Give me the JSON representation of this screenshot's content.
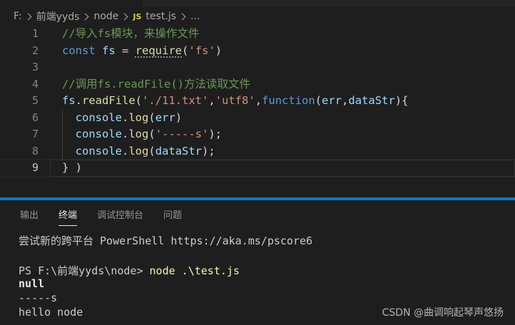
{
  "breadcrumb": {
    "drive": "F:",
    "folder1": "前端yyds",
    "folder2": "node",
    "file_icon": "JS",
    "file": "test.js",
    "more": "..."
  },
  "editor": {
    "lines": [
      {
        "num": "1",
        "tokens": [
          {
            "t": "//导入fs模块，来操作文件",
            "c": "comment"
          }
        ]
      },
      {
        "num": "2",
        "tokens": [
          {
            "t": "const",
            "c": "keyword"
          },
          {
            "t": " ",
            "c": "text"
          },
          {
            "t": "fs",
            "c": "var"
          },
          {
            "t": " = ",
            "c": "text"
          },
          {
            "t": "require",
            "c": "func squiggle"
          },
          {
            "t": "(",
            "c": "text"
          },
          {
            "t": "'fs'",
            "c": "string"
          },
          {
            "t": ")",
            "c": "text"
          }
        ]
      },
      {
        "num": "3",
        "tokens": []
      },
      {
        "num": "4",
        "tokens": [
          {
            "t": "//调用fs.readFile()方法读取文件",
            "c": "comment"
          }
        ]
      },
      {
        "num": "5",
        "tokens": [
          {
            "t": "fs",
            "c": "var"
          },
          {
            "t": ".",
            "c": "text"
          },
          {
            "t": "readFile",
            "c": "func"
          },
          {
            "t": "(",
            "c": "text"
          },
          {
            "t": "'./11.txt'",
            "c": "string"
          },
          {
            "t": ",",
            "c": "text"
          },
          {
            "t": "'utf8'",
            "c": "string"
          },
          {
            "t": ",",
            "c": "text"
          },
          {
            "t": "function",
            "c": "keyword"
          },
          {
            "t": "(",
            "c": "text"
          },
          {
            "t": "err",
            "c": "var"
          },
          {
            "t": ",",
            "c": "text"
          },
          {
            "t": "dataStr",
            "c": "var"
          },
          {
            "t": "){",
            "c": "text"
          }
        ]
      },
      {
        "num": "6",
        "tokens": [
          {
            "t": "  ",
            "c": "text"
          },
          {
            "t": "console",
            "c": "var"
          },
          {
            "t": ".",
            "c": "text"
          },
          {
            "t": "log",
            "c": "func"
          },
          {
            "t": "(",
            "c": "text"
          },
          {
            "t": "err",
            "c": "var"
          },
          {
            "t": ")",
            "c": "text"
          }
        ]
      },
      {
        "num": "7",
        "tokens": [
          {
            "t": "  ",
            "c": "text"
          },
          {
            "t": "console",
            "c": "var"
          },
          {
            "t": ".",
            "c": "text"
          },
          {
            "t": "log",
            "c": "func"
          },
          {
            "t": "(",
            "c": "text"
          },
          {
            "t": "'-----s'",
            "c": "string"
          },
          {
            "t": ");",
            "c": "text"
          }
        ]
      },
      {
        "num": "8",
        "tokens": [
          {
            "t": "  ",
            "c": "text"
          },
          {
            "t": "console",
            "c": "var"
          },
          {
            "t": ".",
            "c": "text"
          },
          {
            "t": "log",
            "c": "func"
          },
          {
            "t": "(",
            "c": "text"
          },
          {
            "t": "dataStr",
            "c": "var"
          },
          {
            "t": ");",
            "c": "text"
          }
        ]
      },
      {
        "num": "9",
        "tokens": [
          {
            "t": "} )",
            "c": "text"
          }
        ]
      }
    ],
    "current_line": "9"
  },
  "panel": {
    "tabs": [
      "输出",
      "终端",
      "调试控制台",
      "问题"
    ],
    "active_tab": "终端"
  },
  "terminal": {
    "hint": "尝试新的跨平台 PowerShell https://aka.ms/pscore6",
    "prompt": "PS F:\\前端yyds\\node> ",
    "command": "node .\\test.js",
    "out1": "null",
    "out2": "-----s",
    "out3": "hello node"
  },
  "watermark": "CSDN @曲调响起琴声悠扬"
}
